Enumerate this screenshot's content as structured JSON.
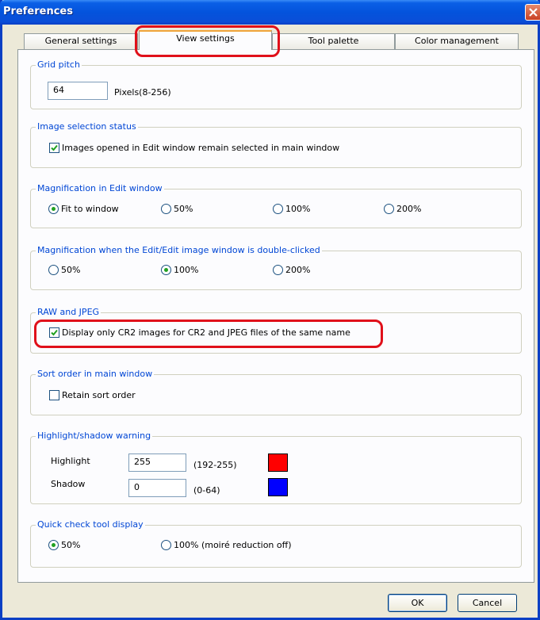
{
  "window": {
    "title": "Preferences"
  },
  "tabs": [
    {
      "label": "General settings"
    },
    {
      "label": "View settings"
    },
    {
      "label": "Tool palette"
    },
    {
      "label": "Color management"
    }
  ],
  "grid_pitch": {
    "legend": "Grid pitch",
    "value": "64",
    "unit": "Pixels(8-256)"
  },
  "image_selection": {
    "legend": "Image selection status",
    "checkbox_label": "Images opened in Edit window remain selected in main window",
    "checked": true
  },
  "magnification_edit": {
    "legend": "Magnification in Edit window",
    "options": [
      "Fit to window",
      "50%",
      "100%",
      "200%"
    ],
    "selected": "Fit to window"
  },
  "magnification_dblclick": {
    "legend": "Magnification when the Edit/Edit image window is double-clicked",
    "options": [
      "50%",
      "100%",
      "200%"
    ],
    "selected": "100%"
  },
  "raw_jpeg": {
    "legend": "RAW and JPEG",
    "checkbox_label": "Display only CR2 images for CR2 and JPEG files of the same name",
    "checked": true
  },
  "sort_order": {
    "legend": "Sort order in main window",
    "checkbox_label": "Retain sort order",
    "checked": false
  },
  "highlight_shadow": {
    "legend": "Highlight/shadow warning",
    "highlight": {
      "label": "Highlight",
      "value": "255",
      "range": "(192-255)",
      "color": "#ff0000"
    },
    "shadow": {
      "label": "Shadow",
      "value": "0",
      "range": "(0-64)",
      "color": "#0000ff"
    }
  },
  "quick_check": {
    "legend": "Quick check tool display",
    "options": [
      "50%",
      "100% (moiré reduction off)"
    ],
    "selected": "50%"
  },
  "buttons": {
    "ok": "OK",
    "cancel": "Cancel"
  },
  "colors": {
    "legend": "#0046d5",
    "highlight_annotation": "#e0101a",
    "titlebar": "#0453dc"
  }
}
